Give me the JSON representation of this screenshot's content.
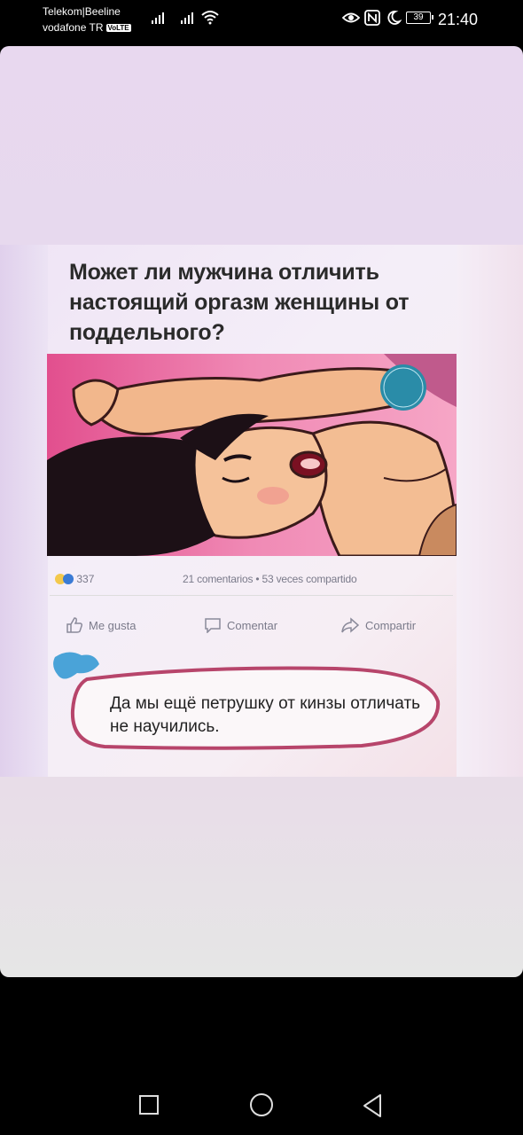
{
  "status_bar": {
    "carrier_line1": "Telekom|Beeline",
    "carrier_line2": "vodafone TR",
    "volte_badge": "VoLTE",
    "battery": "39",
    "time": "21:40",
    "icons": [
      "signal-icon",
      "signal-icon",
      "wifi-icon",
      "eye-icon",
      "nfc-icon",
      "moon-icon",
      "battery-icon"
    ]
  },
  "post": {
    "title": "Может ли мужчина отличить настоящий оргазм женщины от поддельного?",
    "reactions_count": "337",
    "stats": "21 comentarios • 53 veces compartido",
    "actions": {
      "like": "Me gusta",
      "comment": "Comentar",
      "share": "Compartir"
    },
    "comment_text": "Да мы ещё петрушку от кинзы отличать не научились."
  },
  "nav_bar": {
    "icons": [
      "recent-apps-icon",
      "home-icon",
      "back-icon"
    ]
  }
}
